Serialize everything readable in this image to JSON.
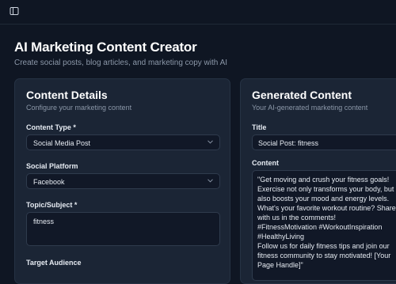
{
  "app": {
    "title": "AI Marketing Content Creator",
    "subtitle": "Create social posts, blog articles, and marketing copy with AI"
  },
  "icons": {
    "sidebar_toggle": "sidebar-toggle-icon",
    "chevron": "chevron-down-icon"
  },
  "details": {
    "title": "Content Details",
    "description": "Configure your marketing content",
    "content_type": {
      "label": "Content Type *",
      "value": "Social Media Post"
    },
    "platform": {
      "label": "Social Platform",
      "value": "Facebook"
    },
    "topic": {
      "label": "Topic/Subject *",
      "value": "fitness"
    },
    "audience": {
      "label": "Target Audience"
    }
  },
  "generated": {
    "title": "Generated Content",
    "description": "Your AI-generated marketing content",
    "title_field": {
      "label": "Title",
      "value": "Social Post: fitness"
    },
    "content_field": {
      "label": "Content",
      "value": "\"Get moving and crush your fitness goals! Exercise not only transforms your body, but also boosts your mood and energy levels. What's your favorite workout routine? Share with us in the comments!\n#FitnessMotivation #WorkoutInspiration #HealthyLiving\nFollow us for daily fitness tips and join our fitness community to stay motivated! [Your Page Handle]\""
    }
  },
  "colors": {
    "background": "#0f1623",
    "card": "#1b2535",
    "input": "#111827",
    "border": "#2f3b4d",
    "muted_text": "#8b97a8"
  }
}
